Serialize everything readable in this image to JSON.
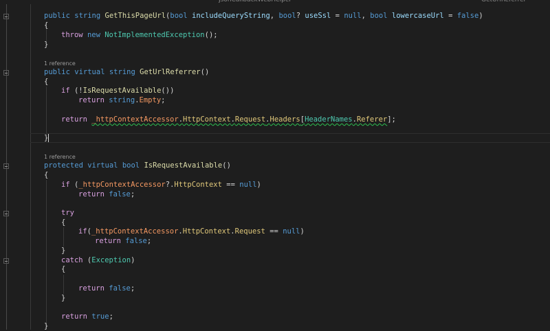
{
  "tabs": {
    "left": "JsonCallbackWebHelper",
    "right": "GetUrlReferrer"
  },
  "codelens": {
    "a": "1 reference",
    "b": "1 reference",
    "c": "1 reference"
  },
  "code": {
    "l1": {
      "public": "public",
      "string": "string",
      "method": "GetThisPageUrl",
      "open": "(",
      "bool1": "bool",
      "p1": "includeQueryString",
      "comma1": ", ",
      "bool2": "bool",
      "q": "? ",
      "p2": "useSsl",
      "eq1": " = ",
      "null1": "null",
      "comma2": ", ",
      "bool3": "bool",
      "p3": "lowercaseUrl",
      "eq2": " = ",
      "false1": "false",
      "close": ")"
    },
    "l2": "{",
    "l3": {
      "throw": "throw",
      "new": "new",
      "type": "NotImplementedException",
      "rest": "();"
    },
    "l4": "}",
    "l5": {
      "public": "public",
      "virtual": "virtual",
      "string": "string",
      "method": "GetUrlReferrer",
      "rest": "()"
    },
    "l6": "{",
    "l7": {
      "if": "if",
      "open": " (!",
      "call": "IsRequestAvailable",
      "rest": "())"
    },
    "l8": {
      "return": "return",
      "string": "string",
      "dot": ".",
      "empty": "Empty",
      "semi": ";"
    },
    "l9": {
      "return": "return",
      "field": "_httpContextAccessor",
      "d1": ".",
      "ctx": "HttpContext",
      "d2": ".",
      "req": "Request",
      "d3": ".",
      "hdr": "Headers",
      "br1": "[",
      "hn": "HeaderNames",
      "d4": ".",
      "ref": "Referer",
      "br2": "];"
    },
    "l10": "}",
    "l11": {
      "protected": "protected",
      "virtual": "virtual",
      "bool": "bool",
      "method": "IsRequestAvailable",
      "rest": "()"
    },
    "l12": "{",
    "l13": {
      "if": "if",
      "open": " (",
      "field": "_httpContextAccessor",
      "q": "?.",
      "ctx": "HttpContext",
      "eq": " == ",
      "null": "null",
      "close": ")"
    },
    "l14": {
      "return": "return",
      "false": "false",
      "semi": ";"
    },
    "l15": "try",
    "l16": "{",
    "l17": {
      "if": "if",
      "open": "(",
      "field": "_httpContextAccessor",
      "d1": ".",
      "ctx": "HttpContext",
      "d2": ".",
      "req": "Request",
      "eq": " == ",
      "null": "null",
      "close": ")"
    },
    "l18": {
      "return": "return",
      "false": "false",
      "semi": ";"
    },
    "l19": "}",
    "l20": {
      "catch": "catch",
      "open": " (",
      "type": "Exception",
      "close": ")"
    },
    "l21": "{",
    "l22": {
      "return": "return",
      "false": "false",
      "semi": ";"
    },
    "l23": "}",
    "l24": {
      "return": "return",
      "true": "true",
      "semi": ";"
    },
    "l25": "}"
  },
  "colors": {
    "background": "#1e1e1e",
    "keyword": "#569cd6",
    "control": "#d8a0df",
    "method": "#dcdcaa",
    "type": "#4ec9b0",
    "parameter": "#9cdcfe",
    "field": "#f59962",
    "property": "#e0c87a"
  }
}
